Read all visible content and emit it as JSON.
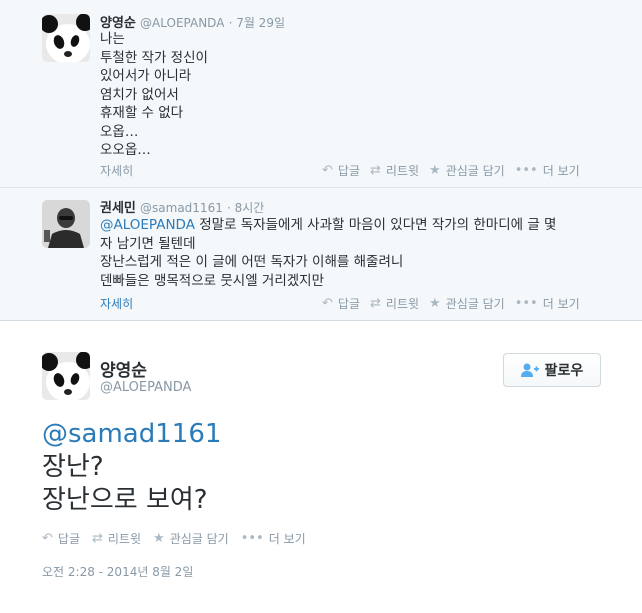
{
  "reply1": {
    "name": "양영순",
    "handle": "@ALOEPANDA",
    "time": "· 7월 29일",
    "lines": [
      "나는",
      "투철한 작가 정신이",
      "있어서가 아니라",
      "염치가 없어서",
      "휴재할 수 없다",
      "오옵…",
      "오오옵…"
    ],
    "expand": "자세히"
  },
  "reply2": {
    "name": "권세민",
    "handle": "@samad1161",
    "time": "· 8시간",
    "mention": "@ALOEPANDA",
    "line1_rest": " 정말로 독자들에게 사과할 마음이 있다면 작가의 한마디에 글 몇",
    "line2": "자 남기면 될텐데",
    "line3": "장난스럽게 적은 이 글에 어떤 독자가 이해를 해줄려니",
    "line4": "덴빠들은 맹목적으로 뭇시엘 거리겠지만",
    "expand": "자세히"
  },
  "actions": {
    "reply": "답글",
    "retweet": "리트윗",
    "favorite": "관심글 담기",
    "more": "더 보기"
  },
  "main": {
    "name": "양영순",
    "handle": "@ALOEPANDA",
    "follow_label": "팔로우",
    "mention": "@samad1161",
    "line1": "장난?",
    "line2": "장난으로 보여?",
    "timestamp": "오전 2:28 - 2014년 8월 2일"
  },
  "colors": {
    "link": "#2b7bb9",
    "muted": "#8899a6",
    "reply_bg": "#f5f8fa"
  }
}
